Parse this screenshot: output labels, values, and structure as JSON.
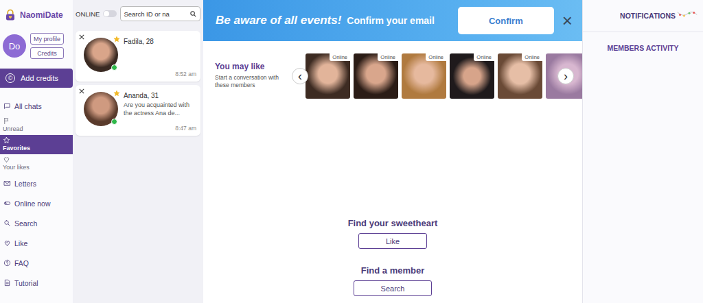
{
  "logo": "NaomiDate",
  "profile": {
    "initials": "Do",
    "buttons": [
      "My profile",
      "Credits"
    ]
  },
  "add_credits": {
    "icon": "©",
    "label": "Add credits"
  },
  "nav": [
    {
      "label": "All chats",
      "kind": "inline",
      "selected": false
    },
    {
      "label": "Unread",
      "kind": "stacked",
      "selected": false
    },
    {
      "label": "Favorites",
      "kind": "stacked",
      "selected": true
    },
    {
      "label": "Your likes",
      "kind": "stacked",
      "selected": false
    },
    {
      "label": "Letters",
      "kind": "inline",
      "selected": false
    },
    {
      "label": "Online now",
      "kind": "inline",
      "selected": false
    },
    {
      "label": "Search",
      "kind": "inline",
      "selected": false
    },
    {
      "label": "Like",
      "kind": "inline",
      "selected": false
    },
    {
      "label": "FAQ",
      "kind": "inline",
      "selected": false
    },
    {
      "label": "Tutorial",
      "kind": "inline",
      "selected": false
    }
  ],
  "online_filter": {
    "label": "ONLINE",
    "on": false
  },
  "search": {
    "placeholder": "Search ID or na"
  },
  "chats": [
    {
      "name": "Fadila, 28",
      "message": "",
      "time": "8:52 am",
      "favorite": true,
      "online": true
    },
    {
      "name": "Ananda, 31",
      "message": "Are you acquainted with the actress Ana de...",
      "time": "8:47 am",
      "favorite": true,
      "online": true
    }
  ],
  "banner": {
    "title": "Be aware of all events!",
    "subtitle": "Confirm your email",
    "button": "Confirm",
    "close": "×"
  },
  "suggestions": {
    "title": "You may like",
    "subtitle": "Start a conversation with these members",
    "badge": "Online",
    "prev": "‹",
    "next": "›",
    "members": [
      {
        "online": true
      },
      {
        "online": true
      },
      {
        "online": true
      },
      {
        "online": true
      },
      {
        "online": true
      },
      {
        "online": false
      }
    ]
  },
  "actions": [
    {
      "heading": "Find your sweetheart",
      "button": "Like"
    },
    {
      "heading": "Find a member",
      "button": "Search"
    }
  ],
  "right": {
    "notifications": "NOTIFICATIONS",
    "activity": "MEMBERS ACTIVITY"
  }
}
